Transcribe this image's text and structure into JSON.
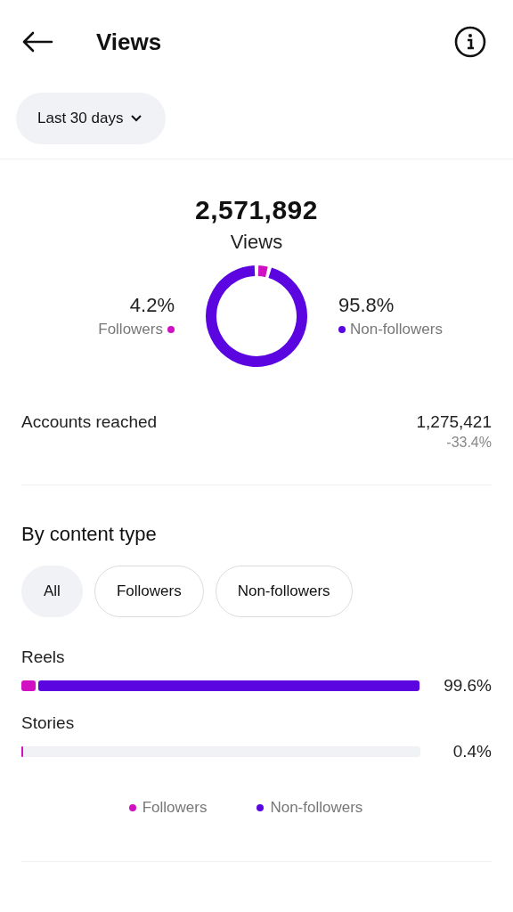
{
  "header": {
    "title": "Views"
  },
  "period": {
    "label": "Last 30 days"
  },
  "total": {
    "value": "2,571,892",
    "label": "Views"
  },
  "donut": [
    {
      "percent": "4.2%",
      "name": "Followers",
      "color": "#d10fc3"
    },
    {
      "percent": "95.8%",
      "name": "Non-followers",
      "color": "#5b06e0"
    }
  ],
  "accounts_reached": {
    "label": "Accounts reached",
    "value": "1,275,421",
    "change": "-33.4%"
  },
  "by_content_type": {
    "title": "By content type",
    "filters": [
      {
        "label": "All",
        "selected": true
      },
      {
        "label": "Followers",
        "selected": false
      },
      {
        "label": "Non-followers",
        "selected": false
      }
    ],
    "rows": [
      {
        "name": "Reels",
        "value": "99.6%",
        "segments": [
          {
            "color": "#d10fc3",
            "level": 0.04
          },
          {
            "color": "#5b06e0",
            "level": 0.96
          }
        ]
      },
      {
        "name": "Stories",
        "value": "0.4%",
        "segments": [
          {
            "color": "#d10fc3",
            "level": 0.004
          }
        ]
      }
    ],
    "legend": [
      {
        "name": "Followers",
        "color": "#d10fc3"
      },
      {
        "name": "Non-followers",
        "color": "#5b06e0"
      }
    ]
  }
}
